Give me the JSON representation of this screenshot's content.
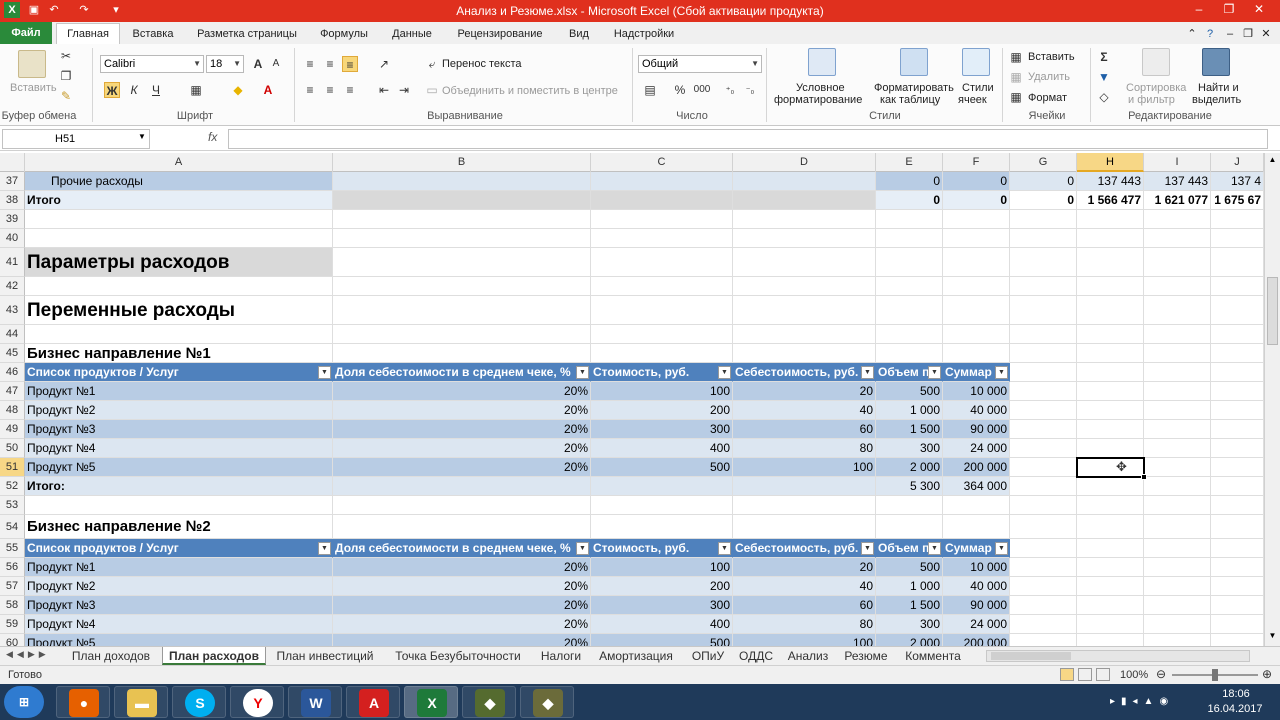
{
  "window": {
    "title": "Анализ и Резюме.xlsx  -  Microsoft Excel (Сбой активации продукта)"
  },
  "ribbon_tabs": [
    "Файл",
    "Главная",
    "Вставка",
    "Разметка страницы",
    "Формулы",
    "Данные",
    "Рецензирование",
    "Вид",
    "Надстройки"
  ],
  "ribbon": {
    "paste": "Вставить",
    "clipboard_group": "Буфер обмена",
    "font_name": "Calibri",
    "font_size": "18",
    "bold": "Ж",
    "italic": "К",
    "underline": "Ч",
    "font_group": "Шрифт",
    "wrap_text": "Перенос текста",
    "merge_center": "Объединить и поместить в центре",
    "alignment_group": "Выравнивание",
    "number_format": "Общий",
    "percent": "%",
    "thousands": "000",
    "number_group": "Число",
    "cond_format_1": "Условное",
    "cond_format_2": "форматирование",
    "format_table_1": "Форматировать",
    "format_table_2": "как таблицу",
    "cell_styles_1": "Стили",
    "cell_styles_2": "ячеек",
    "styles_group": "Стили",
    "insert": "Вставить",
    "delete": "Удалить",
    "format": "Формат",
    "cells_group": "Ячейки",
    "sort_1": "Сортировка",
    "sort_2": "и фильтр",
    "find_1": "Найти и",
    "find_2": "выделить",
    "editing_group": "Редактирование"
  },
  "formula_bar": {
    "name_box": "H51",
    "fx": "fx",
    "formula": ""
  },
  "columns": [
    "A",
    "B",
    "C",
    "D",
    "E",
    "F",
    "G",
    "H",
    "I",
    "J"
  ],
  "rows": {
    "r37": {
      "num": "37",
      "a": "Прочие расходы",
      "e": "0",
      "f": "0",
      "g": "0",
      "h": "137 443",
      "i": "137 443",
      "j": "137 4"
    },
    "r38": {
      "num": "38",
      "a": "Итого",
      "e": "0",
      "f": "0",
      "g": "0",
      "h": "1 566 477",
      "i": "1 621 077",
      "j": "1 675 67"
    },
    "r39": {
      "num": "39"
    },
    "r40": {
      "num": "40"
    },
    "r41": {
      "num": "41",
      "a": "Параметры расходов"
    },
    "r42": {
      "num": "42"
    },
    "r43": {
      "num": "43",
      "a": "Переменные расходы"
    },
    "r44": {
      "num": "44"
    },
    "r45": {
      "num": "45",
      "a": "Бизнес направление №1"
    },
    "r46": {
      "num": "46",
      "a": "Список продуктов / Услуг",
      "b": "Доля себестоимости в среднем чеке, %",
      "c": "Стоимость, руб.",
      "d": "Себестоимость, руб.",
      "e": "Объем п",
      "f": "Суммар"
    },
    "r47": {
      "num": "47",
      "a": "Продукт №1",
      "b": "20%",
      "c": "100",
      "d": "20",
      "e": "500",
      "f": "10 000"
    },
    "r48": {
      "num": "48",
      "a": "Продукт №2",
      "b": "20%",
      "c": "200",
      "d": "40",
      "e": "1 000",
      "f": "40 000"
    },
    "r49": {
      "num": "49",
      "a": "Продукт №3",
      "b": "20%",
      "c": "300",
      "d": "60",
      "e": "1 500",
      "f": "90 000"
    },
    "r50": {
      "num": "50",
      "a": "Продукт №4",
      "b": "20%",
      "c": "400",
      "d": "80",
      "e": "300",
      "f": "24 000"
    },
    "r51": {
      "num": "51",
      "a": "Продукт №5",
      "b": "20%",
      "c": "500",
      "d": "100",
      "e": "2 000",
      "f": "200 000"
    },
    "r52": {
      "num": "52",
      "a": "Итого:",
      "e": "5 300",
      "f": "364 000"
    },
    "r53": {
      "num": "53"
    },
    "r54": {
      "num": "54",
      "a": "Бизнес направление №2"
    },
    "r55": {
      "num": "55",
      "a": "Список продуктов / Услуг",
      "b": "Доля себестоимости в среднем чеке, %",
      "c": "Стоимость, руб.",
      "d": "Себестоимость, руб.",
      "e": "Объем п",
      "f": "Суммар"
    },
    "r56": {
      "num": "56",
      "a": "Продукт №1",
      "b": "20%",
      "c": "100",
      "d": "20",
      "e": "500",
      "f": "10 000"
    },
    "r57": {
      "num": "57",
      "a": "Продукт №2",
      "b": "20%",
      "c": "200",
      "d": "40",
      "e": "1 000",
      "f": "40 000"
    },
    "r58": {
      "num": "58",
      "a": "Продукт №3",
      "b": "20%",
      "c": "300",
      "d": "60",
      "e": "1 500",
      "f": "90 000"
    },
    "r59": {
      "num": "59",
      "a": "Продукт №4",
      "b": "20%",
      "c": "400",
      "d": "80",
      "e": "300",
      "f": "24 000"
    },
    "r60": {
      "num": "60",
      "a": "Продукт №5",
      "b": "20%",
      "c": "500",
      "d": "100",
      "e": "2 000",
      "f": "200 000"
    }
  },
  "sheet_tabs": [
    "План доходов",
    "План расходов",
    "План инвестиций",
    "Точка Безубыточности",
    "Налоги",
    "Амортизация",
    "ОПиУ",
    "ОДДС",
    "Анализ",
    "Резюме",
    "Коммента"
  ],
  "status": {
    "ready": "Готово",
    "zoom": "100%"
  },
  "clock": {
    "time": "18:06",
    "date": "16.04.2017"
  },
  "colors": {
    "titlebar": "#e0301e",
    "table_header": "#4f81bd",
    "band_dark": "#b8cce4",
    "band_light": "#dce6f1",
    "selection": "#f7d786"
  }
}
